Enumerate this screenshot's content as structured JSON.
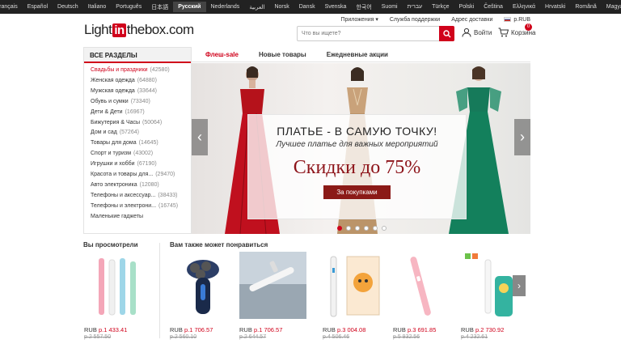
{
  "languages": [
    "Français",
    "Español",
    "Deutsch",
    "Italiano",
    "Português",
    "日本語",
    "Русский",
    "Nederlands",
    "العربية",
    "Norsk",
    "Dansk",
    "Svenska",
    "한국어",
    "Suomi",
    "עברית",
    "Türkçe",
    "Polski",
    "Čeština",
    "Ελληνικά",
    "Hrvatski",
    "Română",
    "Magyar"
  ],
  "active_language": "Русский",
  "header": {
    "logo_pre": "Light",
    "logo_in": "in",
    "logo_post": "thebox.com",
    "apps": "Приложения",
    "support": "Служба поддержки",
    "address": "Адрес доставки",
    "currency": "р.RUB",
    "search_placeholder": "Что вы ищете?",
    "login": "Войти",
    "cart": "Корзина",
    "cart_count": "0"
  },
  "sidebar": {
    "title": "ВСЕ РАЗДЕЛЫ",
    "items": [
      {
        "name": "Свадьбы и праздники",
        "count": "(42580)"
      },
      {
        "name": "Женская одежда",
        "count": "(64880)"
      },
      {
        "name": "Мужская одежда",
        "count": "(33644)"
      },
      {
        "name": "Обувь и сумки",
        "count": "(73340)"
      },
      {
        "name": "Дети & Дети",
        "count": "(16967)"
      },
      {
        "name": "Бижутерия & Часы",
        "count": "(50064)"
      },
      {
        "name": "Дом и сад",
        "count": "(57264)"
      },
      {
        "name": "Товары для дома",
        "count": "(14645)"
      },
      {
        "name": "Спорт и туризм",
        "count": "(43002)"
      },
      {
        "name": "Игрушки и хобби",
        "count": "(67190)"
      },
      {
        "name": "Красота и товары для...",
        "count": "(29470)"
      },
      {
        "name": "Авто электроника",
        "count": "(12080)"
      },
      {
        "name": "Телефоны и аксессуар...",
        "count": "(38433)"
      },
      {
        "name": "Телефоны и электрони...",
        "count": "(16745)"
      },
      {
        "name": "Маленькие гаджеты",
        "count": ""
      }
    ]
  },
  "tabs": [
    "Флеш-sale",
    "Новые товары",
    "Ежедневные акции"
  ],
  "banner": {
    "line1": "ПЛАТЬЕ - В САМУЮ ТОЧКУ!",
    "line2": "Лучшее платье для важных мероприятий",
    "line3": "Скидки до 75%",
    "button": "За покупками",
    "active_slide": 1,
    "slides": 6
  },
  "recent_title": "Вы просмотрели",
  "recommend_title": "Вам также может понравиться",
  "products": [
    {
      "price": "р.1 433.41",
      "old": "р.2 557.50",
      "icon": "toothbrush-pastel-icon"
    },
    {
      "price": "р.1 706.57",
      "old": "р.2 560.10",
      "icon": "electric-shaver-icon"
    },
    {
      "price": "р.1 706.57",
      "old": "р.2 644.57",
      "icon": "toothbrush-towel-icon"
    },
    {
      "price": "р.3 004.08",
      "old": "р.4 506.46",
      "icon": "toothbrush-box-icon"
    },
    {
      "price": "р.3 691.85",
      "old": "р.5 932.56",
      "icon": "toothbrush-pink-icon"
    },
    {
      "price": "р.2 730.92",
      "old": "р.4 232.61",
      "icon": "kids-toothbrush-icon"
    }
  ],
  "currency_prefix": "RUB",
  "colors": {
    "accent": "#d0021b",
    "dark": "#222222"
  }
}
